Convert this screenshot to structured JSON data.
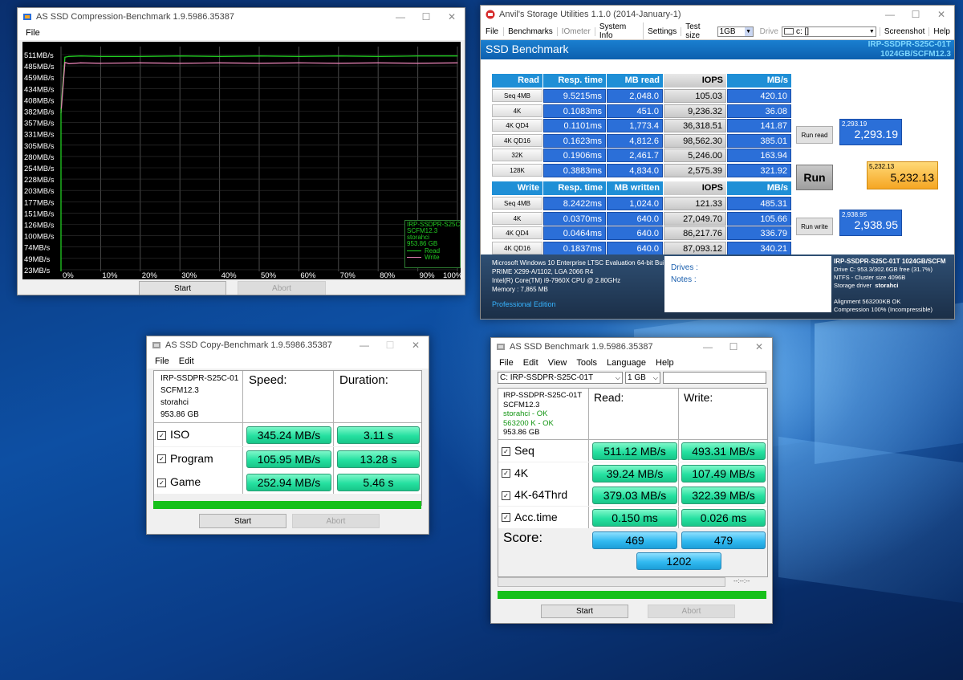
{
  "compression": {
    "title": "AS SSD Compression-Benchmark 1.9.5986.35387",
    "menu": [
      "File"
    ],
    "y_labels": [
      "511MB/s",
      "485MB/s",
      "459MB/s",
      "434MB/s",
      "408MB/s",
      "382MB/s",
      "357MB/s",
      "331MB/s",
      "305MB/s",
      "280MB/s",
      "254MB/s",
      "228MB/s",
      "203MB/s",
      "177MB/s",
      "151MB/s",
      "126MB/s",
      "100MB/s",
      "74MB/s",
      "49MB/s",
      "23MB/s"
    ],
    "x_labels": [
      "0%",
      "10%",
      "20%",
      "30%",
      "40%",
      "50%",
      "60%",
      "70%",
      "80%",
      "90%",
      "100%"
    ],
    "legend": {
      "drive": "IRP-SSDPR-S25C-01",
      "firmware": "SCFM12.3",
      "driver": "storahci",
      "size": "953.86 GB",
      "read": "Read",
      "write": "Write"
    },
    "start": "Start",
    "abort": "Abort",
    "colors": {
      "read": "#22cc22",
      "write": "#e07fb0"
    }
  },
  "chart_data": {
    "type": "line",
    "x": [
      0,
      1,
      2,
      5,
      10,
      20,
      30,
      40,
      50,
      60,
      70,
      80,
      90,
      100
    ],
    "series": [
      {
        "name": "Read",
        "values": [
          380,
          500,
          502,
          503,
          502,
          502,
          503,
          502,
          503,
          502,
          503,
          502,
          503,
          503
        ]
      },
      {
        "name": "Write",
        "values": [
          370,
          488,
          485,
          487,
          486,
          487,
          486,
          487,
          486,
          487,
          486,
          487,
          486,
          487
        ]
      }
    ],
    "ylim": [
      0,
      525
    ],
    "grid": true,
    "legend": "bottom-right"
  },
  "anvil": {
    "title": "Anvil's Storage Utilities 1.1.0 (2014-January-1)",
    "menu": [
      "File",
      "Benchmarks",
      "IOmeter",
      "System Info",
      "Settings"
    ],
    "test_size_label": "Test size",
    "test_size": "1GB",
    "drive_label": "Drive",
    "drive": "c: []",
    "screenshot": "Screenshot",
    "help": "Help",
    "heading": "SSD Benchmark",
    "drive_name": "IRP-SSDPR-S25C-01T",
    "drive_model": "1024GB/SCFM12.3",
    "read_headers": [
      "Read",
      "Resp. time",
      "MB read",
      "IOPS",
      "MB/s"
    ],
    "read_rows": [
      [
        "Seq 4MB",
        "9.5215ms",
        "2,048.0",
        "105.03",
        "420.10"
      ],
      [
        "4K",
        "0.1083ms",
        "451.0",
        "9,236.32",
        "36.08"
      ],
      [
        "4K QD4",
        "0.1101ms",
        "1,773.4",
        "36,318.51",
        "141.87"
      ],
      [
        "4K QD16",
        "0.1623ms",
        "4,812.6",
        "98,562.30",
        "385.01"
      ],
      [
        "32K",
        "0.1906ms",
        "2,461.7",
        "5,246.00",
        "163.94"
      ],
      [
        "128K",
        "0.3883ms",
        "4,834.0",
        "2,575.39",
        "321.92"
      ]
    ],
    "write_headers": [
      "Write",
      "Resp. time",
      "MB written",
      "IOPS",
      "MB/s"
    ],
    "write_rows": [
      [
        "Seq 4MB",
        "8.2422ms",
        "1,024.0",
        "121.33",
        "485.31"
      ],
      [
        "4K",
        "0.0370ms",
        "640.0",
        "27,049.70",
        "105.66"
      ],
      [
        "4K QD4",
        "0.0464ms",
        "640.0",
        "86,217.76",
        "336.79"
      ],
      [
        "4K QD16",
        "0.1837ms",
        "640.0",
        "87,093.12",
        "340.21"
      ]
    ],
    "run_read": "Run read",
    "read_score_small": "2,293.19",
    "read_score": "2,293.19",
    "run": "Run",
    "total_score_small": "5,232.13",
    "total_score": "5,232.13",
    "run_write": "Run write",
    "write_score_small": "2,938.95",
    "write_score": "2,938.95",
    "sys_lines": [
      "Microsoft Windows 10 Enterprise LTSC Evaluation 64-bit Build (1",
      "PRIME X299-A/1102, LGA 2066 R4",
      "Intel(R) Core(TM) i9-7960X CPU @ 2.80GHz",
      "Memory : 7,865 MB"
    ],
    "edition": "Professional Edition",
    "drives_label": "Drives :",
    "notes_label": "Notes :",
    "info_title": "IRP-SSDPR-S25C-01T 1024GB/SCFM",
    "info_lines": [
      "Drive C: 953.3/302.6GB free (31.7%)",
      "NTFS - Cluster size 4096B",
      "Storage driver  storahci",
      "",
      "Alignment 563200KB OK",
      "Compression 100% (Incompressible)"
    ]
  },
  "copy": {
    "title": "AS SSD Copy-Benchmark 1.9.5986.35387",
    "menu": [
      "File",
      "Edit"
    ],
    "drive_lines": [
      "IRP-SSDPR-S25C-01",
      "SCFM12.3",
      "storahci",
      "953.86 GB"
    ],
    "speed_hdr": "Speed:",
    "duration_hdr": "Duration:",
    "rows": [
      {
        "label": "ISO",
        "speed": "345.24 MB/s",
        "duration": "3.11 s"
      },
      {
        "label": "Program",
        "speed": "105.95 MB/s",
        "duration": "13.28 s"
      },
      {
        "label": "Game",
        "speed": "252.94 MB/s",
        "duration": "5.46 s"
      }
    ],
    "start": "Start",
    "abort": "Abort"
  },
  "asssd": {
    "title": "AS SSD Benchmark 1.9.5986.35387",
    "menu": [
      "File",
      "Edit",
      "View",
      "Tools",
      "Language",
      "Help"
    ],
    "drive_select": "C: IRP-SSDPR-S25C-01T",
    "size_select": "1 GB",
    "drive_lines": [
      "IRP-SSDPR-S25C-01T",
      "SCFM12.3"
    ],
    "ok_lines": [
      "storahci - OK",
      "563200 K - OK"
    ],
    "size_line": "953.86 GB",
    "read_hdr": "Read:",
    "write_hdr": "Write:",
    "rows": [
      {
        "label": "Seq",
        "read": "511.12 MB/s",
        "write": "493.31 MB/s"
      },
      {
        "label": "4K",
        "read": "39.24 MB/s",
        "write": "107.49 MB/s"
      },
      {
        "label": "4K-64Thrd",
        "read": "379.03 MB/s",
        "write": "322.39 MB/s"
      },
      {
        "label": "Acc.time",
        "read": "0.150 ms",
        "write": "0.026 ms"
      }
    ],
    "score_label": "Score:",
    "score_read": "469",
    "score_write": "479",
    "score_total": "1202",
    "time": "--:--:--",
    "start": "Start",
    "abort": "Abort"
  }
}
